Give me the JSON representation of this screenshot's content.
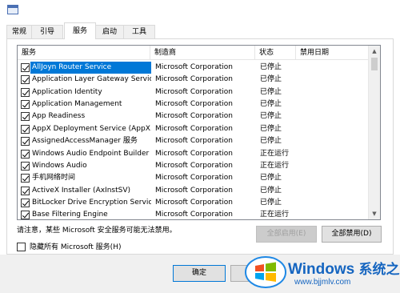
{
  "tabs": [
    {
      "label": "常规"
    },
    {
      "label": "引导"
    },
    {
      "label": "服务"
    },
    {
      "label": "启动"
    },
    {
      "label": "工具"
    }
  ],
  "columns": {
    "service": "服务",
    "manufacturer": "制造商",
    "status": "状态",
    "disabled_date": "禁用日期"
  },
  "rows": [
    {
      "name": "AllJoyn Router Service",
      "manufacturer": "Microsoft Corporation",
      "status": "已停止"
    },
    {
      "name": "Application Layer Gateway Service",
      "manufacturer": "Microsoft Corporation",
      "status": "已停止"
    },
    {
      "name": "Application Identity",
      "manufacturer": "Microsoft Corporation",
      "status": "已停止"
    },
    {
      "name": "Application Management",
      "manufacturer": "Microsoft Corporation",
      "status": "已停止"
    },
    {
      "name": "App Readiness",
      "manufacturer": "Microsoft Corporation",
      "status": "已停止"
    },
    {
      "name": "AppX Deployment Service (AppX...",
      "manufacturer": "Microsoft Corporation",
      "status": "已停止"
    },
    {
      "name": "AssignedAccessManager 服务",
      "manufacturer": "Microsoft Corporation",
      "status": "已停止"
    },
    {
      "name": "Windows Audio Endpoint Builder",
      "manufacturer": "Microsoft Corporation",
      "status": "正在运行"
    },
    {
      "name": "Windows Audio",
      "manufacturer": "Microsoft Corporation",
      "status": "正在运行"
    },
    {
      "name": "手机网络时间",
      "manufacturer": "Microsoft Corporation",
      "status": "已停止"
    },
    {
      "name": "ActiveX Installer (AxInstSV)",
      "manufacturer": "Microsoft Corporation",
      "status": "已停止"
    },
    {
      "name": "BitLocker Drive Encryption Service",
      "manufacturer": "Microsoft Corporation",
      "status": "已停止"
    },
    {
      "name": "Base Filtering Engine",
      "manufacturer": "Microsoft Corporation",
      "status": "正在运行"
    }
  ],
  "note": "请注意，某些 Microsoft 安全服务可能无法禁用。",
  "buttons": {
    "enable_all": "全部启用(E)",
    "disable_all": "全部禁用(D)",
    "ok": "确定"
  },
  "hide_ms_label": "隐藏所有 Microsoft 服务(H)",
  "watermark": {
    "brand": "Windows",
    "suffix": "系统之家",
    "url": "www.bjjmlv.com"
  },
  "colors": {
    "selection": "#0078d7",
    "watermark": "#1565c0"
  }
}
